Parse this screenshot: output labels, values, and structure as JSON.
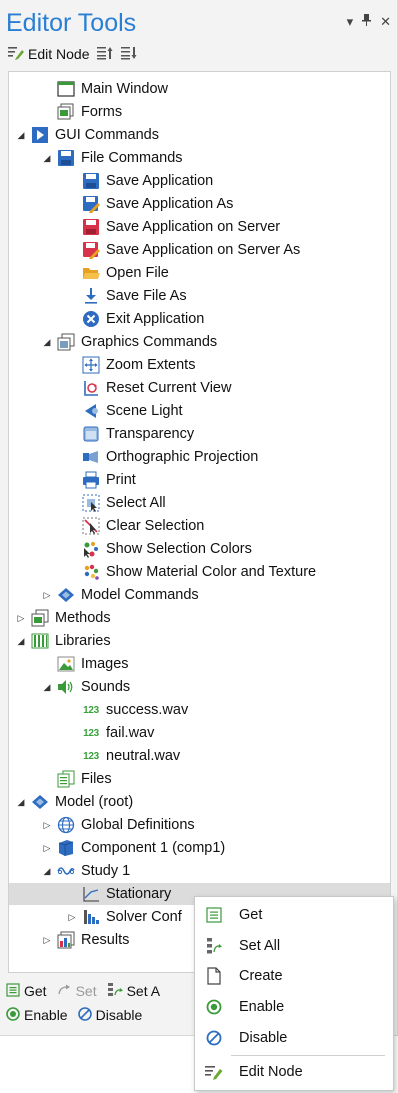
{
  "panel": {
    "title": "Editor Tools",
    "controls": [
      "▾",
      "✖",
      "✕"
    ]
  },
  "toolbar": {
    "edit_node_label": "Edit Node"
  },
  "tree": [
    {
      "id": "main-window",
      "label": "Main Window",
      "icon": "window-icon",
      "level": 1,
      "arrow": ""
    },
    {
      "id": "forms",
      "label": "Forms",
      "icon": "forms-icon",
      "level": 1,
      "arrow": ""
    },
    {
      "id": "gui-commands",
      "label": "GUI Commands",
      "icon": "play-icon",
      "level": 0,
      "arrow": "down"
    },
    {
      "id": "file-commands",
      "label": "File Commands",
      "icon": "save-icon",
      "level": 1,
      "arrow": "down"
    },
    {
      "id": "save-application",
      "label": "Save Application",
      "icon": "save-icon",
      "level": 2,
      "arrow": ""
    },
    {
      "id": "save-application-as",
      "label": "Save Application As",
      "icon": "save-as-icon",
      "level": 2,
      "arrow": ""
    },
    {
      "id": "save-app-server",
      "label": "Save Application on Server",
      "icon": "save-server-icon",
      "level": 2,
      "arrow": ""
    },
    {
      "id": "save-app-server-as",
      "label": "Save Application on Server As",
      "icon": "save-server-as-icon",
      "level": 2,
      "arrow": ""
    },
    {
      "id": "open-file",
      "label": "Open File",
      "icon": "folder-icon",
      "level": 2,
      "arrow": ""
    },
    {
      "id": "save-file-as",
      "label": "Save File As",
      "icon": "download-icon",
      "level": 2,
      "arrow": ""
    },
    {
      "id": "exit-application",
      "label": "Exit Application",
      "icon": "exit-icon",
      "level": 2,
      "arrow": ""
    },
    {
      "id": "graphics-commands",
      "label": "Graphics Commands",
      "icon": "graphics-icon",
      "level": 1,
      "arrow": "down"
    },
    {
      "id": "zoom-extents",
      "label": "Zoom Extents",
      "icon": "zoom-extents-icon",
      "level": 2,
      "arrow": ""
    },
    {
      "id": "reset-view",
      "label": "Reset Current View",
      "icon": "reset-view-icon",
      "level": 2,
      "arrow": ""
    },
    {
      "id": "scene-light",
      "label": "Scene Light",
      "icon": "light-icon",
      "level": 2,
      "arrow": ""
    },
    {
      "id": "transparency",
      "label": "Transparency",
      "icon": "transparency-icon",
      "level": 2,
      "arrow": ""
    },
    {
      "id": "ortho-projection",
      "label": "Orthographic Projection",
      "icon": "projection-icon",
      "level": 2,
      "arrow": ""
    },
    {
      "id": "print",
      "label": "Print",
      "icon": "print-icon",
      "level": 2,
      "arrow": ""
    },
    {
      "id": "select-all",
      "label": "Select All",
      "icon": "select-all-icon",
      "level": 2,
      "arrow": ""
    },
    {
      "id": "clear-selection",
      "label": "Clear Selection",
      "icon": "clear-selection-icon",
      "level": 2,
      "arrow": ""
    },
    {
      "id": "show-selection-colors",
      "label": "Show Selection Colors",
      "icon": "selection-colors-icon",
      "level": 2,
      "arrow": ""
    },
    {
      "id": "show-material",
      "label": "Show Material Color and Texture",
      "icon": "material-icon",
      "level": 2,
      "arrow": ""
    },
    {
      "id": "model-commands",
      "label": "Model Commands",
      "icon": "model-icon",
      "level": 1,
      "arrow": "right"
    },
    {
      "id": "methods",
      "label": "Methods",
      "icon": "methods-icon",
      "level": 0,
      "arrow": "right"
    },
    {
      "id": "libraries",
      "label": "Libraries",
      "icon": "libraries-icon",
      "level": 0,
      "arrow": "down"
    },
    {
      "id": "images",
      "label": "Images",
      "icon": "images-icon",
      "level": 1,
      "arrow": ""
    },
    {
      "id": "sounds",
      "label": "Sounds",
      "icon": "sound-icon",
      "level": 1,
      "arrow": "down"
    },
    {
      "id": "success-wav",
      "label": "success.wav",
      "icon": "number-icon",
      "level": 2,
      "arrow": ""
    },
    {
      "id": "fail-wav",
      "label": "fail.wav",
      "icon": "number-icon",
      "level": 2,
      "arrow": ""
    },
    {
      "id": "neutral-wav",
      "label": "neutral.wav",
      "icon": "number-icon",
      "level": 2,
      "arrow": ""
    },
    {
      "id": "files",
      "label": "Files",
      "icon": "files-icon",
      "level": 1,
      "arrow": ""
    },
    {
      "id": "model-root",
      "label": "Model (root)",
      "icon": "model-icon",
      "level": 0,
      "arrow": "down"
    },
    {
      "id": "global-definitions",
      "label": "Global Definitions",
      "icon": "globe-icon",
      "level": 1,
      "arrow": "right"
    },
    {
      "id": "component-1",
      "label": "Component 1 (comp1)",
      "icon": "component-icon",
      "level": 1,
      "arrow": "right"
    },
    {
      "id": "study-1",
      "label": "Study 1",
      "icon": "study-icon",
      "level": 1,
      "arrow": "down"
    },
    {
      "id": "stationary",
      "label": "Stationary",
      "icon": "stationary-icon",
      "level": 2,
      "arrow": "",
      "selected": true
    },
    {
      "id": "solver-conf",
      "label": "Solver Conf",
      "icon": "solver-icon",
      "level": 2,
      "arrow": "right"
    },
    {
      "id": "results",
      "label": "Results",
      "icon": "results-icon",
      "level": 1,
      "arrow": "right"
    }
  ],
  "number_icon_text": "123",
  "bottom": {
    "get_label": "Get",
    "set_label": "Set",
    "set_all_label": "Set A",
    "enable_label": "Enable",
    "disable_label": "Disable"
  },
  "context_menu": {
    "items": [
      {
        "id": "get",
        "label": "Get",
        "icon": "list-icon"
      },
      {
        "id": "set-all",
        "label": "Set All",
        "icon": "set-all-icon"
      },
      {
        "id": "create",
        "label": "Create",
        "icon": "create-icon"
      },
      {
        "id": "enable",
        "label": "Enable",
        "icon": "enable-icon"
      },
      {
        "id": "disable",
        "label": "Disable",
        "icon": "disable-icon"
      },
      {
        "id": "edit-node",
        "label": "Edit Node",
        "icon": "edit-node-icon"
      }
    ]
  }
}
